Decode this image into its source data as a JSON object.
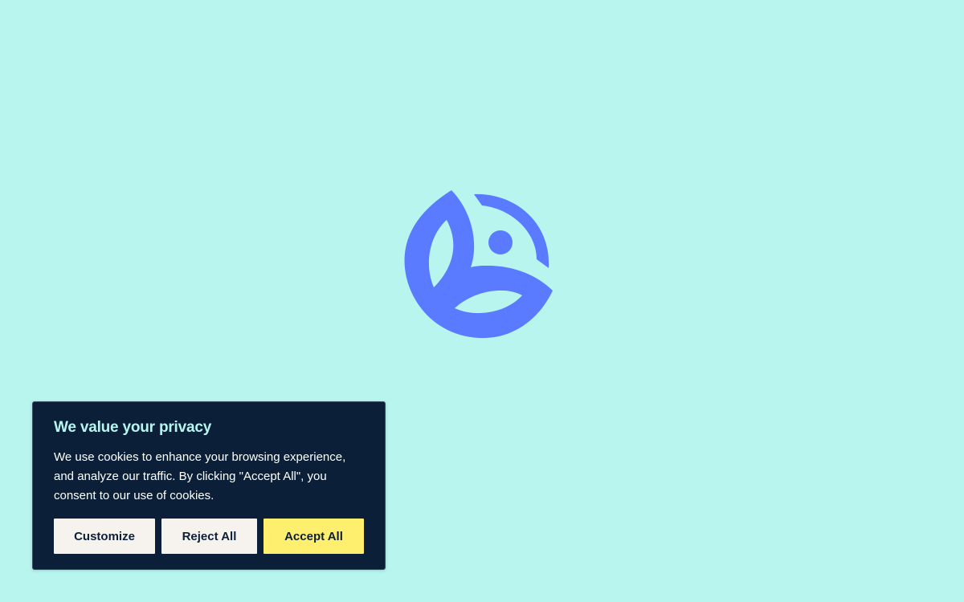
{
  "colors": {
    "background": "#b8f5ef",
    "logo": "#5a7bff",
    "banner_background": "#0b2038",
    "banner_title": "#b8f5ef",
    "button_light": "#f6f3ef",
    "button_accept": "#ffef6e"
  },
  "logo": {
    "icon": "brand-logo-icon"
  },
  "cookie_banner": {
    "title": "We value your privacy",
    "message": "We use cookies to enhance your browsing experience, and analyze our traffic. By clicking \"Accept All\", you consent to our use of cookies.",
    "buttons": {
      "customize": "Customize",
      "reject_all": "Reject All",
      "accept_all": "Accept All"
    }
  }
}
